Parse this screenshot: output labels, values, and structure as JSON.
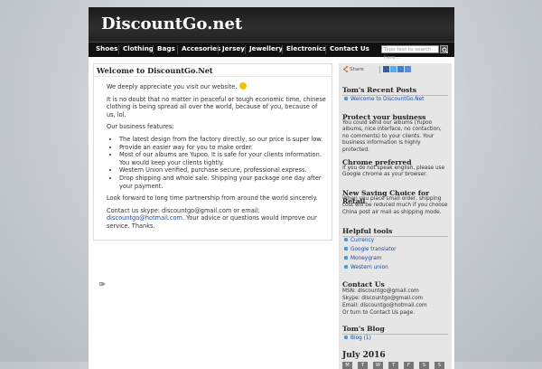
{
  "site": {
    "title": "DiscountGo.net"
  },
  "nav": {
    "items": [
      "Shoes",
      "Clothing",
      "Bags",
      "Accesories",
      "Jersey",
      "Jewellery",
      "Electronics",
      "Contact Us"
    ],
    "search_placeholder": "Type text to search here..."
  },
  "post": {
    "title": "Welcome to DiscountGo.Net",
    "greeting": "We deeply appreciate you visit our website.",
    "intro": "It is no doubt that no matter in peaceful or tough economic time, chinese clothing is being spread all over the world, because of you, because of us, lol.",
    "features_heading": "Our business features:",
    "features": [
      "The latest design from the factory directly, so our price is super low.",
      "Provide an easier way for you to make order.",
      "Most of our albums are Yupoo. It is safe for your clients information.  You would keep your clients tightly.",
      "Western Union verified, purchase secure, professional express.",
      "Drop shipping and whole sale. Shipping your package one day after your payment."
    ],
    "closing": "Look forward to long time partnership from around the world sincerely.",
    "contact_prefix": "Contact us skype: discountgo@gmail.com or email:",
    "contact_email": "discountgo@hotmail.com",
    "contact_suffix": ". Your advice or questions would improve our service. Thanks."
  },
  "sidebar": {
    "share_label": "Share",
    "recent_posts": {
      "heading": "Tom's Recent Posts",
      "items": [
        "Welcome to DiscountGo.Net"
      ]
    },
    "protect": {
      "heading": "Protect your business",
      "text": "You could send our albums (Yupoo albums, nice interface, no contaction, no comments) to your clients. Your business information is highly protected."
    },
    "chrome": {
      "heading": "Chrome preferred",
      "text": "If you do not speak english, please use Google chrome as your browser."
    },
    "saving": {
      "heading": "New Saving Choice for Retail",
      "text": "When you place small order, shipping cost will be reduced much if you choose China post air mail as shipping mode."
    },
    "tools": {
      "heading": "Helpful tools",
      "items": [
        "Currency",
        "Google translator",
        "Moneygram",
        "Western union"
      ]
    },
    "contact": {
      "heading": "Contact Us",
      "lines": [
        "MSN: discountgo@gmail.com",
        "Skype: discountgo@gmail.com",
        "Email: discountgo@hotmail.com",
        "Or turn to Contact Us page."
      ]
    },
    "blog": {
      "heading": "Tom's Blog",
      "items": [
        "Blog (1)"
      ]
    },
    "calendar": {
      "heading": "July 2016",
      "days": [
        "M",
        "T",
        "W",
        "T",
        "F",
        "S",
        "S"
      ]
    }
  }
}
